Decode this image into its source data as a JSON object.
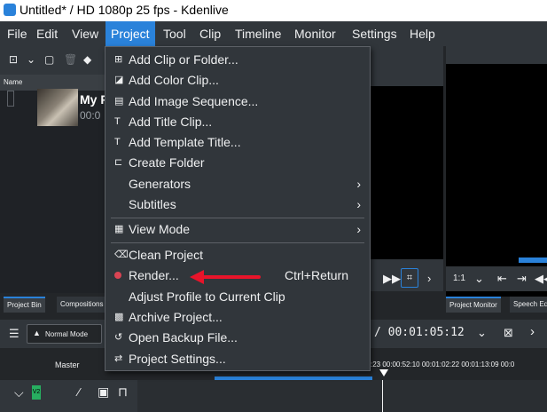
{
  "window": {
    "title": "Untitled* / HD 1080p 25 fps - Kdenlive"
  },
  "menubar": [
    "File",
    "Edit",
    "View",
    "Project",
    "Tool",
    "Clip",
    "Timeline",
    "Monitor",
    "Settings",
    "Help"
  ],
  "bin": {
    "column_name": "Name",
    "clip_name": "My P",
    "clip_time": "00:0"
  },
  "project_menu": {
    "add_clip": "Add Clip or Folder...",
    "add_color": "Add Color Clip...",
    "add_image_seq": "Add Image Sequence...",
    "add_title": "Add Title Clip...",
    "add_template_title": "Add Template Title...",
    "create_folder": "Create Folder",
    "generators": "Generators",
    "subtitles": "Subtitles",
    "view_mode": "View Mode",
    "clean_project": "Clean Project",
    "render": "Render...",
    "render_shortcut": "Ctrl+Return",
    "adjust_profile": "Adjust Profile to Current Clip",
    "archive": "Archive Project...",
    "open_backup": "Open Backup File...",
    "project_settings": "Project Settings..."
  },
  "tabs": {
    "project_bin": "Project Bin",
    "compositions": "Compositions",
    "project_monitor": "Project Monitor",
    "speech": "Speech Ed"
  },
  "monitor": {
    "zoom": "1:1"
  },
  "timeline": {
    "mode": "Normal Mode",
    "timecode": "/  00:01:05:12",
    "master": "Master",
    "track_badge": "V2",
    "ruler": ":23    00:00:52:10    00:01:02:22    00:01:13:09    00:0"
  },
  "colors": {
    "accent": "#2a82da",
    "menu_bg": "#31363b",
    "record": "#da4453",
    "arrow": "#e8142a"
  }
}
